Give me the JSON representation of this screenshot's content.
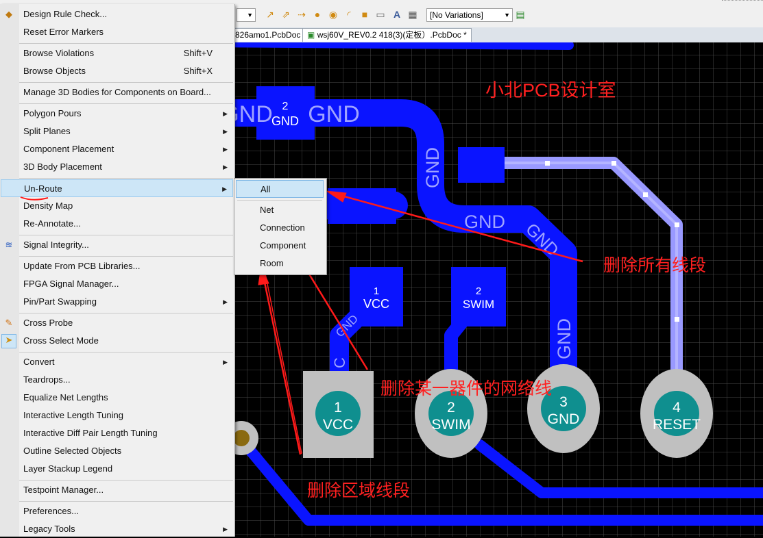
{
  "toolbar": {
    "variations": "[No Variations]",
    "tabs": [
      "826amo1.PcbDoc *",
      "wsj60V_REV0.2 418(3)(定板）.PcbDoc *"
    ]
  },
  "menu": {
    "items": [
      {
        "label": "Design Rule Check...",
        "icon": "drc-icon"
      },
      {
        "label": "Reset Error Markers"
      },
      {
        "label": "Browse Violations",
        "shortcut": "Shift+V"
      },
      {
        "label": "Browse Objects",
        "shortcut": "Shift+X"
      },
      {
        "label": "Manage 3D Bodies for Components on Board..."
      },
      {
        "label": "Polygon Pours",
        "submenu": true
      },
      {
        "label": "Split Planes",
        "submenu": true
      },
      {
        "label": "Component Placement",
        "submenu": true
      },
      {
        "label": "3D Body Placement",
        "submenu": true
      },
      {
        "label": "Un-Route",
        "submenu": true,
        "highlighted": true
      },
      {
        "label": "Density Map"
      },
      {
        "label": "Re-Annotate..."
      },
      {
        "label": "Signal Integrity...",
        "icon": "signal-integrity-icon"
      },
      {
        "label": "Update From PCB Libraries..."
      },
      {
        "label": "FPGA Signal Manager..."
      },
      {
        "label": "Pin/Part Swapping",
        "submenu": true
      },
      {
        "label": "Cross Probe",
        "icon": "cross-probe-icon"
      },
      {
        "label": "Cross Select Mode",
        "icon": "cross-select-icon"
      },
      {
        "label": "Convert",
        "submenu": true
      },
      {
        "label": "Teardrops..."
      },
      {
        "label": "Equalize Net Lengths"
      },
      {
        "label": "Interactive Length Tuning"
      },
      {
        "label": "Interactive Diff Pair Length Tuning"
      },
      {
        "label": "Outline Selected Objects"
      },
      {
        "label": "Layer Stackup Legend"
      },
      {
        "label": "Testpoint Manager..."
      },
      {
        "label": "Preferences..."
      },
      {
        "label": "Legacy Tools",
        "submenu": true
      }
    ]
  },
  "submenu": {
    "items": [
      {
        "label": "All",
        "highlighted": true
      },
      {
        "label": "Net"
      },
      {
        "label": "Connection"
      },
      {
        "label": "Component"
      },
      {
        "label": "Room"
      }
    ]
  },
  "pcb": {
    "pads": [
      {
        "num": "2",
        "net": "GND"
      },
      {
        "num": "1",
        "net": "VCC"
      },
      {
        "num": "2",
        "net": "SWIM"
      },
      {
        "num": "1",
        "net": "VCC"
      },
      {
        "num": "2",
        "net": "SWIM"
      },
      {
        "num": "3",
        "net": "GND"
      },
      {
        "num": "4",
        "net": "RESET"
      }
    ],
    "trace_labels": [
      "GND",
      "GND",
      "GND",
      "GND",
      "GND",
      "GND",
      "GND",
      "C"
    ]
  },
  "annotations": {
    "watermark": "小北PCB设计室",
    "delete_all": "删除所有线段",
    "delete_component": "删除某一器件的网络线",
    "delete_region": "删除区域线段"
  },
  "colors": {
    "board": "#000000",
    "grid": "#555555",
    "track": "#0a14ff",
    "pad_top": "#0a14ff",
    "pad_thru": "#c0c0c0",
    "pad_hole": "#0f8f8f",
    "route_selected": "#9999ff",
    "annotation": "#ff2020",
    "menu_highlight": "#cde6f7"
  }
}
